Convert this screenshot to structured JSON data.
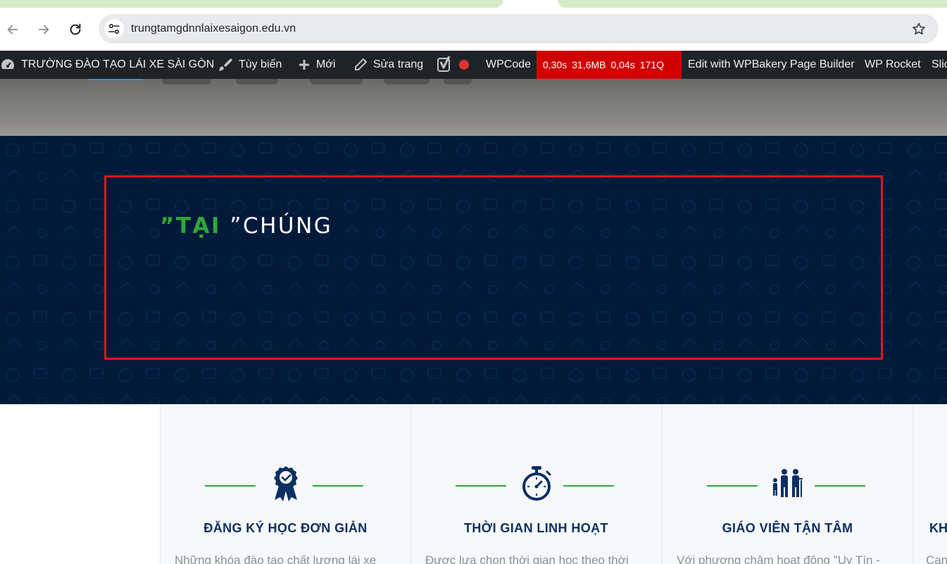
{
  "browser": {
    "url": "trungtamgdnnlaixesaigon.edu.vn"
  },
  "adminbar": {
    "site_name": "TRƯỜNG ĐÀO TẠO LÁI XE SÀI GÒN",
    "customize": "Tùy biến",
    "new": "Mới",
    "edit_page": "Sửa trang",
    "wpcode": "WPCode",
    "perf": {
      "time": "0,30s",
      "memory": "31,6MB",
      "query_time": "0,04s",
      "queries": "171Q"
    },
    "wpbakery": "Edit with WPBakery Page Builder",
    "wprocket": "WP Rocket",
    "slider_partial": "Slic"
  },
  "hero": {
    "headline_green": "”TẠI",
    "headline_white": "”CHÚNG"
  },
  "features": [
    {
      "icon": "award-badge-icon",
      "title": "ĐĂNG KÝ HỌC ĐƠN GIẢN",
      "desc": "Những khóa đào tạo chất lượng lái xe"
    },
    {
      "icon": "stopwatch-icon",
      "title": "THỜI GIAN LINH HOẠT",
      "desc": "Được lựa chọn thời gian học theo thời"
    },
    {
      "icon": "family-icon",
      "title": "GIÁO VIÊN TẬN TÂM",
      "desc": "Với phương châm hoạt động \"Uy Tín -"
    }
  ],
  "edge_card": {
    "title": "KH",
    "desc": "Can"
  },
  "colors": {
    "navy": "#021a3a",
    "green": "#2ea838",
    "title_blue": "#0a2f63",
    "highlight_red": "#e3141b",
    "admin_bar": "#1d2327",
    "perf_red": "#d10000"
  }
}
